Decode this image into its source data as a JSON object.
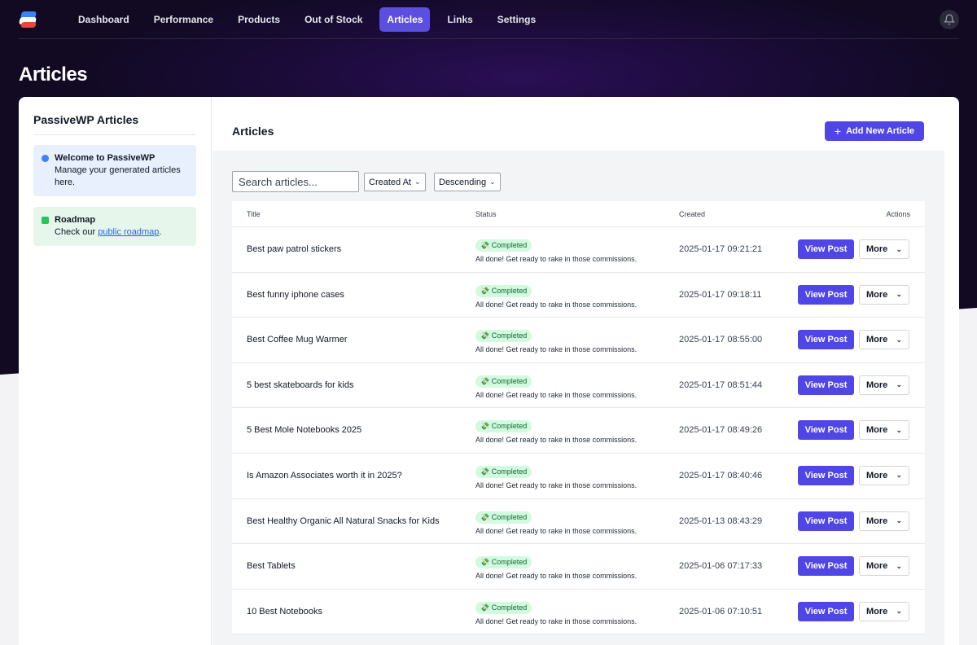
{
  "nav": {
    "items": [
      {
        "label": "Dashboard",
        "active": false
      },
      {
        "label": "Performance",
        "active": false
      },
      {
        "label": "Products",
        "active": false
      },
      {
        "label": "Out of Stock",
        "active": false
      },
      {
        "label": "Articles",
        "active": true
      },
      {
        "label": "Links",
        "active": false
      },
      {
        "label": "Settings",
        "active": false
      }
    ]
  },
  "page": {
    "title": "Articles"
  },
  "sidebar": {
    "title": "PassiveWP Articles",
    "welcome": {
      "title": "Welcome to PassiveWP",
      "text": "Manage your generated articles here."
    },
    "roadmap": {
      "title": "Roadmap",
      "text_before": "Check our ",
      "link": "public roadmap",
      "text_after": "."
    }
  },
  "main": {
    "title": "Articles",
    "add_button": "Add New Article",
    "search_placeholder": "Search articles...",
    "sort_by": "Created At",
    "sort_order": "Descending"
  },
  "table": {
    "headers": {
      "title": "Title",
      "status": "Status",
      "created": "Created",
      "actions": "Actions"
    },
    "view_label": "View Post",
    "more_label": "More",
    "rows": [
      {
        "title": "Best paw patrol stickers",
        "status": "Completed",
        "message": "All done! Get ready to rake in those commissions.",
        "created": "2025-01-17 09:21:21"
      },
      {
        "title": "Best funny iphone cases",
        "status": "Completed",
        "message": "All done! Get ready to rake in those commissions.",
        "created": "2025-01-17 09:18:11"
      },
      {
        "title": "Best Coffee Mug Warmer",
        "status": "Completed",
        "message": "All done! Get ready to rake in those commissions.",
        "created": "2025-01-17 08:55:00"
      },
      {
        "title": "5 best skateboards for kids",
        "status": "Completed",
        "message": "All done! Get ready to rake in those commissions.",
        "created": "2025-01-17 08:51:44"
      },
      {
        "title": "5 Best Mole Notebooks 2025",
        "status": "Completed",
        "message": "All done! Get ready to rake in those commissions.",
        "created": "2025-01-17 08:49:26"
      },
      {
        "title": "Is Amazon Associates worth it in 2025?",
        "status": "Completed",
        "message": "All done! Get ready to rake in those commissions.",
        "created": "2025-01-17 08:40:46"
      },
      {
        "title": "Best Healthy Organic All Natural Snacks for Kids",
        "status": "Completed",
        "message": "All done! Get ready to rake in those commissions.",
        "created": "2025-01-13 08:43:29"
      },
      {
        "title": "Best Tablets",
        "status": "Completed",
        "message": "All done! Get ready to rake in those commissions.",
        "created": "2025-01-06 07:17:33"
      },
      {
        "title": "10 Best Notebooks",
        "status": "Completed",
        "message": "All done! Get ready to rake in those commissions.",
        "created": "2025-01-06 07:10:51"
      }
    ]
  },
  "colors": {
    "accent": "#4f46e5",
    "nav_active": "#5b4fe0",
    "success_bg": "#d1fadf",
    "success_text": "#166534"
  },
  "icons": {
    "status": "money-icon",
    "notifications": "bell-icon",
    "add": "plus-icon",
    "dropdown": "chevron-down-icon"
  }
}
